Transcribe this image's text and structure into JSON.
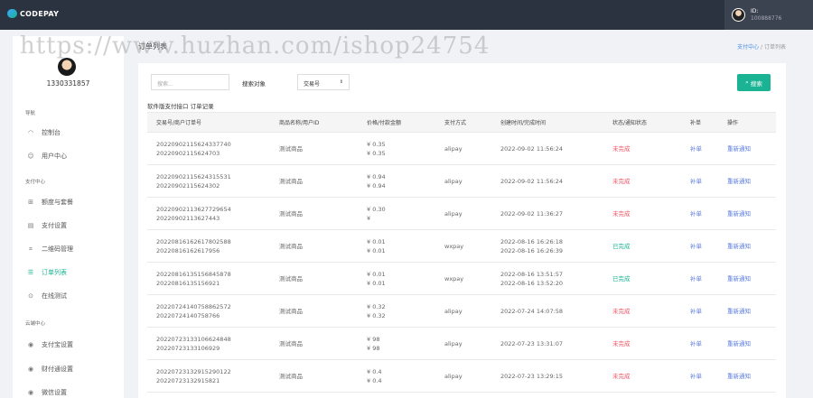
{
  "header": {
    "logo_text": "CODEPAY",
    "user_id_label": "ID:",
    "user_id": "100888776"
  },
  "sidebar": {
    "username": "1330331857",
    "sections": [
      {
        "label": "导航",
        "items": [
          {
            "label": "控制台",
            "icon": "gauge-icon"
          },
          {
            "label": "用户中心",
            "icon": "user-icon"
          }
        ]
      },
      {
        "label": "支付中心",
        "items": [
          {
            "label": "额度与套餐",
            "icon": "package-icon"
          },
          {
            "label": "支付设置",
            "icon": "file-icon"
          },
          {
            "label": "二维码管理",
            "icon": "qrcode-icon"
          },
          {
            "label": "订单列表",
            "icon": "list-icon",
            "active": true
          },
          {
            "label": "在线测试",
            "icon": "test-icon"
          }
        ]
      },
      {
        "label": "云端中心",
        "items": [
          {
            "label": "支付宝设置",
            "icon": "alipay-icon"
          },
          {
            "label": "财付通设置",
            "icon": "tenpay-icon"
          },
          {
            "label": "微信设置",
            "icon": "wechat-icon"
          }
        ]
      }
    ]
  },
  "page": {
    "title": "订单列表",
    "breadcrumb": {
      "parent": "支付中心",
      "separator": "/",
      "current": "订单列表"
    }
  },
  "search": {
    "placeholder": "搜索...",
    "label": "搜索对象",
    "selected": "交易号",
    "button": "搜索"
  },
  "table": {
    "caption": "软件版支付接口 订单记录",
    "columns": [
      "交易号/商户订单号",
      "商品名称/用户ID",
      "价格/付款金额",
      "支付方式",
      "创建时间/完成时间",
      "状态/通知状态",
      "补单",
      "操作"
    ],
    "rows": [
      {
        "trade_no": "20220902115624337740",
        "order_no": "20220902115624703",
        "product": "测试商品",
        "price": "¥ 0.35",
        "paid": "¥ 0.35",
        "method": "alipay",
        "created": "2022-09-02 11:56:24",
        "finished": "",
        "status": "未完成",
        "status_type": "red",
        "supplement": "补单",
        "action": "重新通知"
      },
      {
        "trade_no": "20220902115624315531",
        "order_no": "20220902115624302",
        "product": "测试商品",
        "price": "¥ 0.94",
        "paid": "¥ 0.94",
        "method": "alipay",
        "created": "2022-09-02 11:56:24",
        "finished": "",
        "status": "未完成",
        "status_type": "red",
        "supplement": "补单",
        "action": "重新通知"
      },
      {
        "trade_no": "20220902113627729654",
        "order_no": "20220902113627443",
        "product": "测试商品",
        "price": "¥ 0.30",
        "paid": "¥",
        "method": "alipay",
        "created": "2022-09-02 11:36:27",
        "finished": "",
        "status": "未完成",
        "status_type": "red",
        "supplement": "补单",
        "action": "重新通知"
      },
      {
        "trade_no": "20220816162617802588",
        "order_no": "20220816162617956",
        "product": "测试商品",
        "price": "¥ 0.01",
        "paid": "¥ 0.01",
        "method": "wxpay",
        "created": "2022-08-16 16:26:18",
        "finished": "2022-08-16 16:26:39",
        "status": "已完成",
        "status_type": "green",
        "supplement": "补单",
        "action": "重新通知"
      },
      {
        "trade_no": "20220816135156845878",
        "order_no": "20220816135156921",
        "product": "测试商品",
        "price": "¥ 0.01",
        "paid": "¥ 0.01",
        "method": "wxpay",
        "created": "2022-08-16 13:51:57",
        "finished": "2022-08-16 13:52:20",
        "status": "已完成",
        "status_type": "green",
        "supplement": "补单",
        "action": "重新通知"
      },
      {
        "trade_no": "20220724140758862572",
        "order_no": "20220724140758766",
        "product": "测试商品",
        "price": "¥ 0.32",
        "paid": "¥ 0.32",
        "method": "alipay",
        "created": "2022-07-24 14:07:58",
        "finished": "",
        "status": "未完成",
        "status_type": "red",
        "supplement": "补单",
        "action": "重新通知"
      },
      {
        "trade_no": "20220723133106624848",
        "order_no": "20220723133106929",
        "product": "测试商品",
        "price": "¥ 98",
        "paid": "¥ 98",
        "method": "alipay",
        "created": "2022-07-23 13:31:07",
        "finished": "",
        "status": "未完成",
        "status_type": "red",
        "supplement": "补单",
        "action": "重新通知"
      },
      {
        "trade_no": "20220723132915290122",
        "order_no": "20220723132915821",
        "product": "测试商品",
        "price": "¥ 0.4",
        "paid": "¥ 0.4",
        "method": "alipay",
        "created": "2022-07-23 13:29:15",
        "finished": "",
        "status": "未完成",
        "status_type": "red",
        "supplement": "补单",
        "action": "重新通知"
      }
    ]
  },
  "watermark": "https://www.huzhan.com/ishop24754",
  "colors": {
    "topbar": "#2b3340",
    "accent": "#1ab394",
    "status_red": "#ed5565",
    "link": "#5b7cde"
  }
}
